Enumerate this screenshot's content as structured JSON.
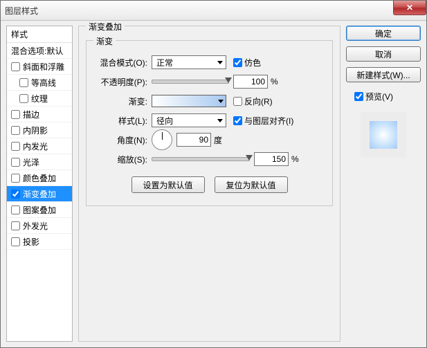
{
  "titlebar": {
    "title": "图层样式"
  },
  "styles": {
    "header": "样式",
    "blend_defaults": "混合选项:默认",
    "items": [
      {
        "label": "斜面和浮雕",
        "indent": false
      },
      {
        "label": "等高线",
        "indent": true
      },
      {
        "label": "纹理",
        "indent": true
      },
      {
        "label": "描边",
        "indent": false
      },
      {
        "label": "内阴影",
        "indent": false
      },
      {
        "label": "内发光",
        "indent": false
      },
      {
        "label": "光泽",
        "indent": false
      },
      {
        "label": "颜色叠加",
        "indent": false
      },
      {
        "label": "渐变叠加",
        "indent": false,
        "selected": true,
        "checked": true
      },
      {
        "label": "图案叠加",
        "indent": false
      },
      {
        "label": "外发光",
        "indent": false
      },
      {
        "label": "投影",
        "indent": false
      }
    ]
  },
  "panel": {
    "group_title": "渐变叠加",
    "inner_title": "渐变",
    "blend_mode_label": "混合模式(O):",
    "blend_mode_value": "正常",
    "dither_label": "仿色",
    "opacity_label": "不透明度(P):",
    "opacity_value": "100",
    "pct": "%",
    "gradient_label": "渐变:",
    "reverse_label": "反向(R)",
    "style_label": "样式(L):",
    "style_value": "径向",
    "align_label": "与图层对齐(I)",
    "angle_label": "角度(N):",
    "angle_value": "90",
    "angle_unit": "度",
    "scale_label": "缩放(S):",
    "scale_value": "150",
    "make_default": "设置为默认值",
    "reset_default": "复位为默认值"
  },
  "sidebar": {
    "ok": "确定",
    "cancel": "取消",
    "new_style": "新建样式(W)...",
    "preview_label": "预览(V)"
  }
}
